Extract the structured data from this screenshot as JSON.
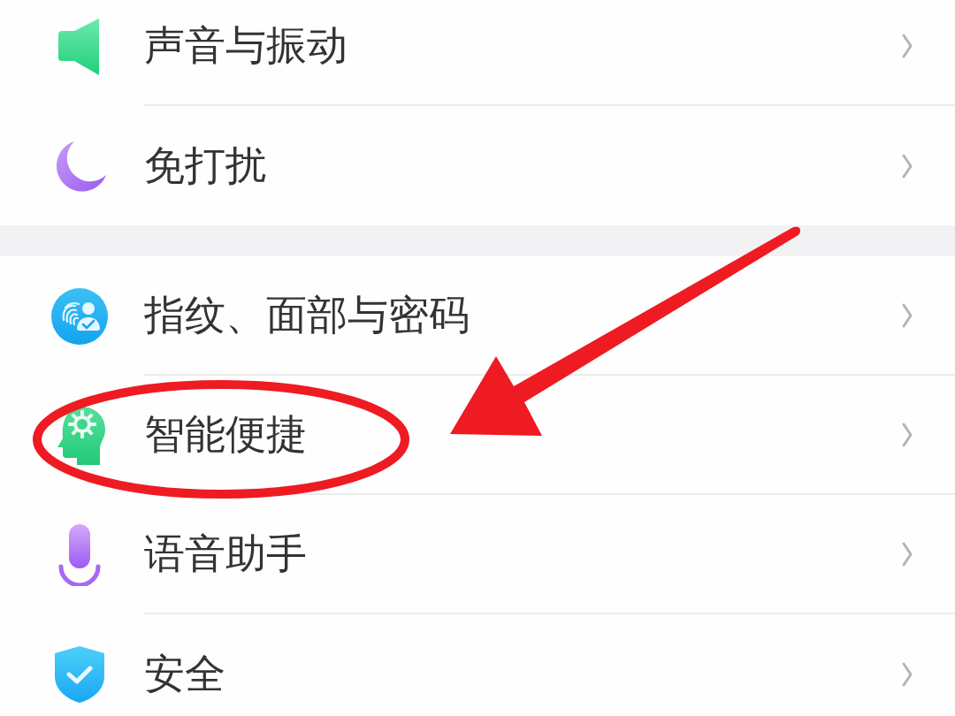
{
  "groups": [
    {
      "items": [
        {
          "label": "声音与振动",
          "circled": false
        },
        {
          "label": "免打扰",
          "circled": false
        }
      ]
    },
    {
      "items": [
        {
          "label": "指纹、面部与密码",
          "circled": false
        },
        {
          "label": "智能便捷",
          "circled": true
        },
        {
          "label": "语音助手",
          "circled": false
        },
        {
          "label": "安全",
          "circled": false
        }
      ]
    }
  ]
}
